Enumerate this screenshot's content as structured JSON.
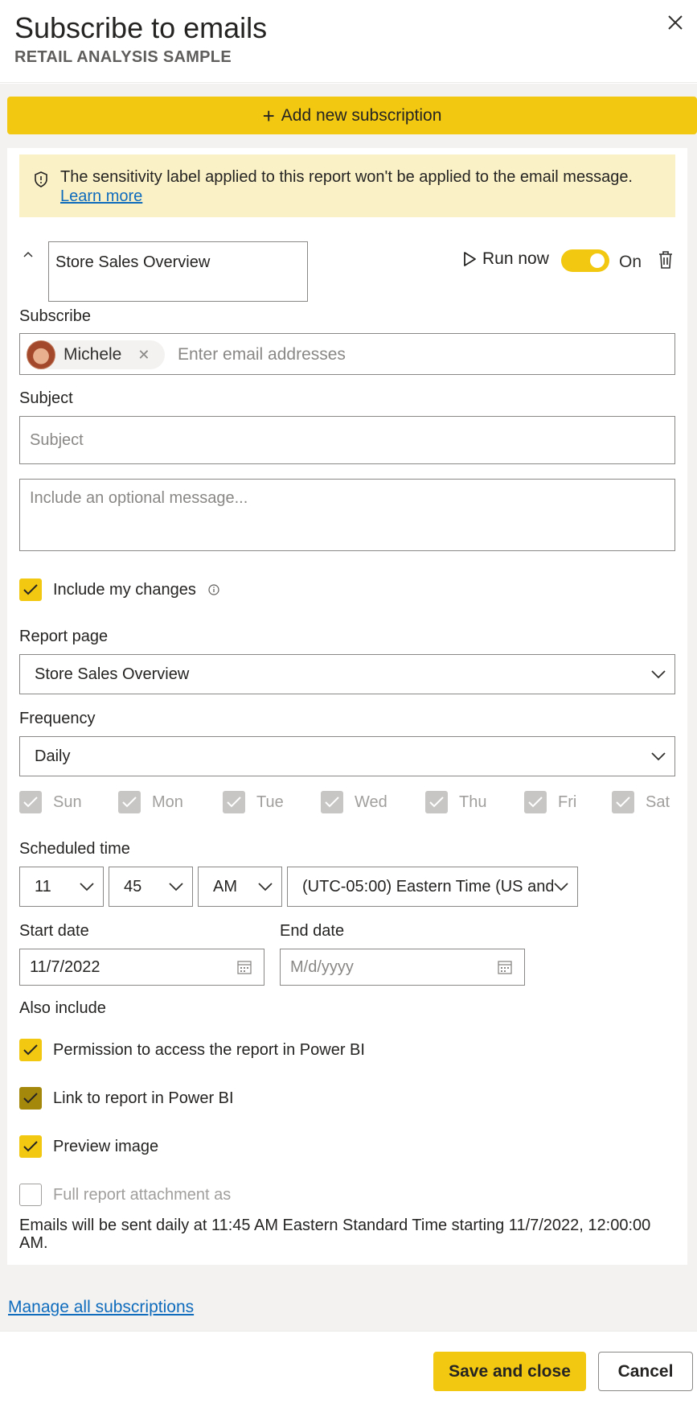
{
  "header": {
    "title": "Subscribe to emails",
    "subtitle": "RETAIL ANALYSIS SAMPLE"
  },
  "add_subscription_label": "Add new subscription",
  "banner": {
    "text": "The sensitivity label applied to this report won't be applied to the email message.",
    "link": "Learn more"
  },
  "subscription": {
    "name": "Store Sales Overview",
    "run_now": "Run now",
    "toggle_state": "On",
    "subscribe_label": "Subscribe",
    "recipient": "Michele",
    "email_placeholder": "Enter email addresses",
    "subject_label": "Subject",
    "subject_placeholder": "Subject",
    "message_placeholder": "Include an optional message...",
    "include_changes_label": "Include my changes",
    "report_page_label": "Report page",
    "report_page_value": "Store Sales Overview",
    "frequency_label": "Frequency",
    "frequency_value": "Daily",
    "days": [
      "Sun",
      "Mon",
      "Tue",
      "Wed",
      "Thu",
      "Fri",
      "Sat"
    ],
    "scheduled_time_label": "Scheduled time",
    "hour": "11",
    "minute": "45",
    "ampm": "AM",
    "timezone": "(UTC-05:00) Eastern Time (US and",
    "start_date_label": "Start date",
    "start_date_value": "11/7/2022",
    "end_date_label": "End date",
    "end_date_placeholder": "M/d/yyyy",
    "also_include_label": "Also include",
    "also_include": {
      "permission": "Permission to access the report in Power BI",
      "link": "Link to report in Power BI",
      "preview": "Preview image",
      "attachment": "Full report attachment as"
    },
    "summary": "Emails will be sent daily at 11:45 AM Eastern Standard Time starting 11/7/2022, 12:00:00 AM."
  },
  "manage_link": "Manage all subscriptions",
  "footer": {
    "save": "Save and close",
    "cancel": "Cancel"
  },
  "colors": {
    "accent": "#f2c811",
    "banner_bg": "#fbf1c6",
    "link": "#0f6cbd",
    "panel_bg": "#f3f2f1"
  }
}
